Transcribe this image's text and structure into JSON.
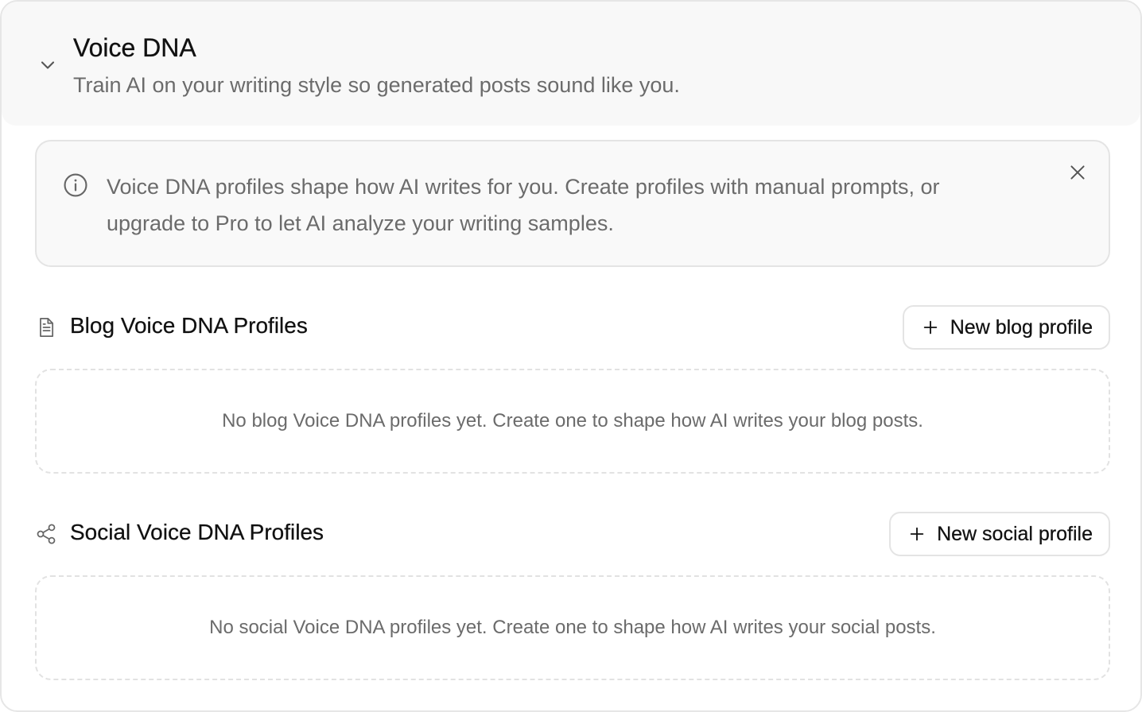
{
  "header": {
    "title": "Voice DNA",
    "subtitle": "Train AI on your writing style so generated posts sound like you.",
    "toggle_icon": "chevron-down-icon"
  },
  "alert": {
    "icon": "info-icon",
    "text": "Voice DNA profiles shape how AI writes for you. Create profiles with manual prompts, or upgrade to Pro to let AI analyze your writing samples.",
    "close_icon": "close-icon"
  },
  "blog": {
    "icon": "document-icon",
    "title": "Blog Voice DNA Profiles",
    "button_label": "New blog profile",
    "empty_text": "No blog Voice DNA profiles yet. Create one to shape how AI writes your blog posts."
  },
  "social": {
    "icon": "share-icon",
    "title": "Social Voice DNA Profiles",
    "button_label": "New social profile",
    "empty_text": "No social Voice DNA profiles yet. Create one to shape how AI writes your social posts."
  },
  "colors": {
    "text_primary": "#111111",
    "text_muted": "#6b6b6b",
    "border": "#e4e4e4",
    "header_bg": "#f8f8f8"
  }
}
